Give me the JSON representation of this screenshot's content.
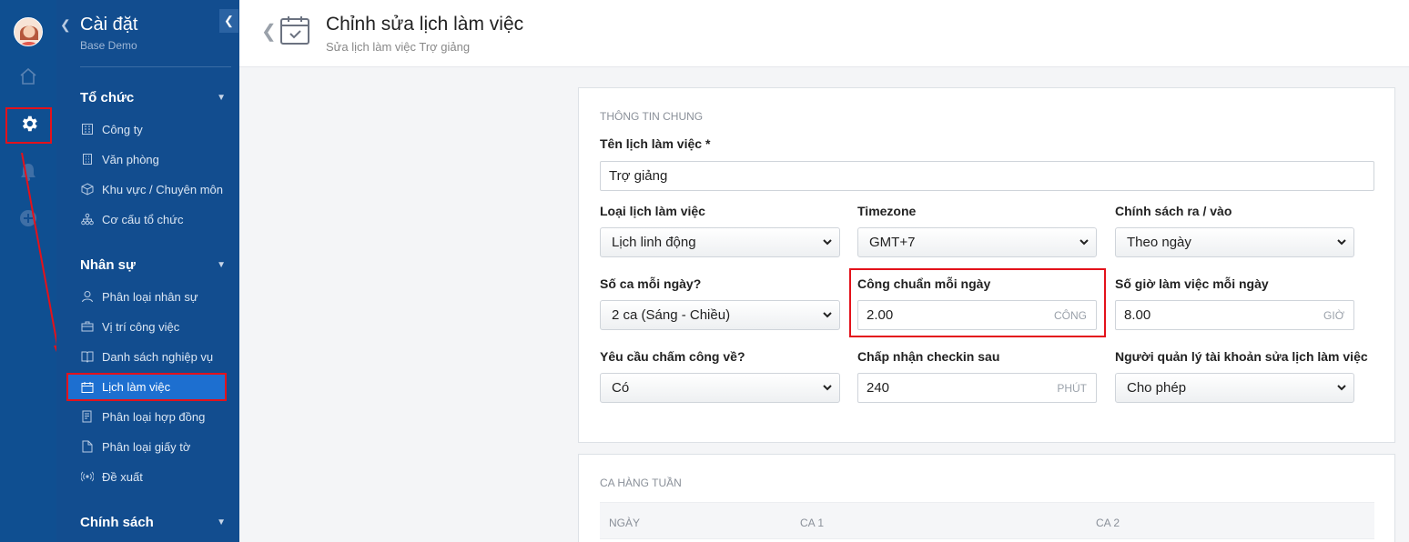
{
  "sidebar": {
    "title": "Cài đặt",
    "subtitle": "Base Demo",
    "sections": [
      {
        "label": "Tổ chức",
        "items": [
          {
            "label": "Công ty",
            "icon": "building-icon"
          },
          {
            "label": "Văn phòng",
            "icon": "office-icon"
          },
          {
            "label": "Khu vực / Chuyên môn",
            "icon": "cube-icon"
          },
          {
            "label": "Cơ cấu tổ chức",
            "icon": "org-chart-icon"
          }
        ]
      },
      {
        "label": "Nhân sự",
        "items": [
          {
            "label": "Phân loại nhân sự",
            "icon": "user-icon"
          },
          {
            "label": "Vị trí công việc",
            "icon": "briefcase-icon"
          },
          {
            "label": "Danh sách nghiệp vụ",
            "icon": "book-icon"
          },
          {
            "label": "Lịch làm việc",
            "icon": "calendar-icon",
            "active": true
          },
          {
            "label": "Phân loại hợp đồng",
            "icon": "contract-icon"
          },
          {
            "label": "Phân loại giấy tờ",
            "icon": "document-icon"
          },
          {
            "label": "Đề xuất",
            "icon": "broadcast-icon"
          }
        ]
      },
      {
        "label": "Chính sách",
        "items": []
      }
    ]
  },
  "header": {
    "title": "Chỉnh sửa lịch làm việc",
    "subtitle": "Sửa lịch làm việc Trợ giảng"
  },
  "general": {
    "section_title": "THÔNG TIN CHUNG",
    "name_label": "Tên lịch làm việc *",
    "name_value": "Trợ giảng",
    "schedule_type": {
      "label": "Loại lịch làm việc",
      "value": "Lịch linh động"
    },
    "timezone": {
      "label": "Timezone",
      "value": "GMT+7"
    },
    "inout_policy": {
      "label": "Chính sách ra / vào",
      "value": "Theo ngày"
    },
    "shifts_per_day": {
      "label": "Số ca mỗi ngày?",
      "value": "2 ca (Sáng - Chiều)"
    },
    "standard_workdays": {
      "label": "Công chuẩn mỗi ngày",
      "value": "2.00",
      "unit": "CÔNG"
    },
    "hours_per_day": {
      "label": "Số giờ làm việc mỗi ngày",
      "value": "8.00",
      "unit": "GIỜ"
    },
    "require_checkout": {
      "label": "Yêu cầu chấm công về?",
      "value": "Có"
    },
    "accept_checkin_after": {
      "label": "Chấp nhận checkin sau",
      "value": "240",
      "unit": "PHÚT"
    },
    "manager_edit": {
      "label": "Người quản lý tài khoản sửa lịch làm việc",
      "value": "Cho phép"
    }
  },
  "weekly": {
    "section_title": "CA HÀNG TUẦN",
    "columns": [
      "NGÀY",
      "CA 1",
      "CA 2"
    ]
  },
  "colors": {
    "sidebar_bg": "#124d8f",
    "rail_bg": "#0f4f91",
    "active_item": "#1d6fd0",
    "annotation_red": "#e3121b"
  }
}
